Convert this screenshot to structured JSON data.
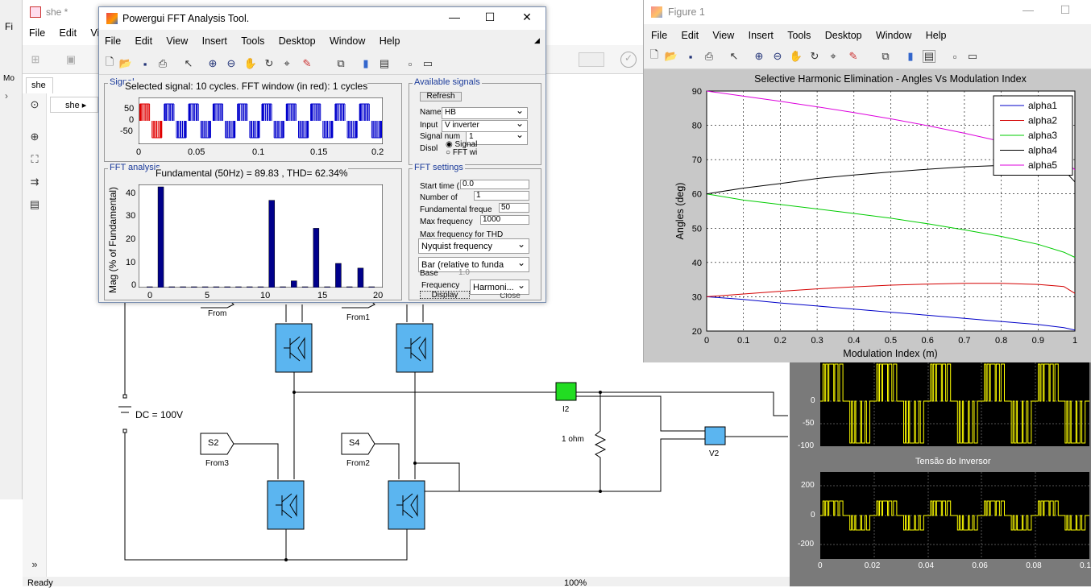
{
  "simulink": {
    "title": "she *",
    "menu": [
      "File",
      "Edit",
      "Vie"
    ],
    "tab": "she",
    "breadcrumb": "she",
    "status": "Ready",
    "zoom": "100%",
    "left_labels": [
      "Mo",
      "Fi"
    ],
    "dc_label": "DC  = 100V",
    "tags": [
      {
        "text": "S2",
        "sub": "From3"
      },
      {
        "text": "S4",
        "sub": "From2"
      }
    ],
    "from_labels": [
      "From",
      "From1"
    ],
    "resistor": "1 ohm",
    "i2": "I2",
    "v2": "V2"
  },
  "fft": {
    "title": "Powergui FFT Analysis Tool.",
    "menu": [
      "File",
      "Edit",
      "View",
      "Insert",
      "Tools",
      "Desktop",
      "Window",
      "Help"
    ],
    "signal_group": "Signal",
    "signal_caption": "Selected signal: 10 cycles. FFT window (in red): 1 cycles",
    "signal_yticks": [
      "50",
      "0",
      "-50"
    ],
    "signal_xticks": [
      "0",
      "0.05",
      "0.1",
      "0.15",
      "0.2"
    ],
    "available_group": "Available signals",
    "refresh": "Refresh",
    "name_label": "Name",
    "name_value": "HB",
    "input_label": "Input",
    "input_value": "V inverter",
    "signum_label": "Signal num",
    "signum_value": "1",
    "display_label": "Displ",
    "radio_signal": "Signal",
    "radio_fft": "FFT wi",
    "analysis_group": "FFT analysis",
    "analysis_caption": "Fundamental (50Hz) = 89.83 , THD= 62.34%",
    "ylabel": "Mag (% of Fundamental)",
    "yticks": [
      "40",
      "30",
      "20",
      "10",
      "0"
    ],
    "xticks": [
      "0",
      "5",
      "10",
      "15",
      "20"
    ],
    "settings_group": "FFT settings",
    "start_label": "Start time (",
    "start_value": "0.0",
    "cycles_label": "Number of",
    "cycles_value": "1",
    "fund_label": "Fundamental freque",
    "fund_value": "50",
    "maxf_label": "Max frequency",
    "maxf_value": "1000",
    "maxthd_label": "Max frequency for THD",
    "maxthd_value": "Nyquist frequency",
    "display_value": "Bar (relative to funda",
    "base_label": "Base",
    "base_value": "1.0",
    "freq_label": "Frequency",
    "freq_value": "Harmoni...",
    "display_btn": "Display",
    "close_btn": "Close",
    "chart_data": {
      "type": "bar",
      "x": [
        0,
        1,
        2,
        3,
        4,
        5,
        6,
        7,
        8,
        9,
        10,
        11,
        12,
        13,
        14,
        15,
        16,
        17,
        18,
        19,
        20
      ],
      "values": [
        0.3,
        45,
        0.2,
        0.2,
        0.2,
        0.3,
        0.2,
        0.2,
        0.2,
        0.2,
        0.2,
        39,
        0.2,
        3,
        0.2,
        26.5,
        0.2,
        10.8,
        0.2,
        8.7,
        0.2
      ],
      "ylim": [
        0,
        45
      ],
      "xlim": [
        -1,
        21
      ]
    }
  },
  "figure": {
    "title": "Figure 1",
    "menu": [
      "File",
      "Edit",
      "View",
      "Insert",
      "Tools",
      "Desktop",
      "Window",
      "Help"
    ],
    "chart_data": {
      "type": "line",
      "title": "Selective Harmonic Elimination - Angles Vs Modulation Index",
      "xlabel": "Modulation Index (m)",
      "ylabel": "Angles (deg)",
      "xlim": [
        0,
        1
      ],
      "ylim": [
        20,
        90
      ],
      "xticks": [
        "0",
        "0.1",
        "0.2",
        "0.3",
        "0.4",
        "0.5",
        "0.6",
        "0.7",
        "0.8",
        "0.9",
        "1"
      ],
      "yticks": [
        "90",
        "80",
        "70",
        "60",
        "50",
        "40",
        "30",
        "20"
      ],
      "x": [
        0,
        0.1,
        0.2,
        0.3,
        0.4,
        0.5,
        0.6,
        0.7,
        0.8,
        0.9,
        0.97,
        1
      ],
      "series": [
        {
          "name": "alpha1",
          "color": "#0000c8",
          "values": [
            30,
            29.2,
            28.2,
            27.3,
            26.4,
            25.5,
            24.6,
            23.7,
            22.8,
            21.9,
            21,
            20.3
          ]
        },
        {
          "name": "alpha2",
          "color": "#d40000",
          "values": [
            30,
            30.8,
            31.6,
            32.3,
            32.9,
            33.4,
            33.7,
            33.9,
            33.9,
            33.6,
            33,
            31
          ]
        },
        {
          "name": "alpha3",
          "color": "#00cc00",
          "values": [
            60,
            58.2,
            56.9,
            55.6,
            54.3,
            52.9,
            51.3,
            49.5,
            47.6,
            45.3,
            43,
            41.5
          ]
        },
        {
          "name": "alpha4",
          "color": "#000000",
          "values": [
            60,
            61.7,
            63,
            64.5,
            65.5,
            66.4,
            67.2,
            67.9,
            68.3,
            68.4,
            67,
            63.5
          ]
        },
        {
          "name": "alpha5",
          "color": "#dd00dd",
          "values": [
            90,
            88.5,
            87,
            85.4,
            83.7,
            81.9,
            79.9,
            77.7,
            75.3,
            72.5,
            70,
            67
          ]
        }
      ],
      "legend": "top-right"
    }
  },
  "scope": {
    "upper_yticks": [
      "0",
      "-50",
      "-100"
    ],
    "lower_title": "Tensão do Inversor",
    "lower_yticks": [
      "200",
      "0",
      "-200"
    ],
    "lower_xticks": [
      "0",
      "0.02",
      "0.04",
      "0.06",
      "0.08",
      "0.1"
    ]
  }
}
